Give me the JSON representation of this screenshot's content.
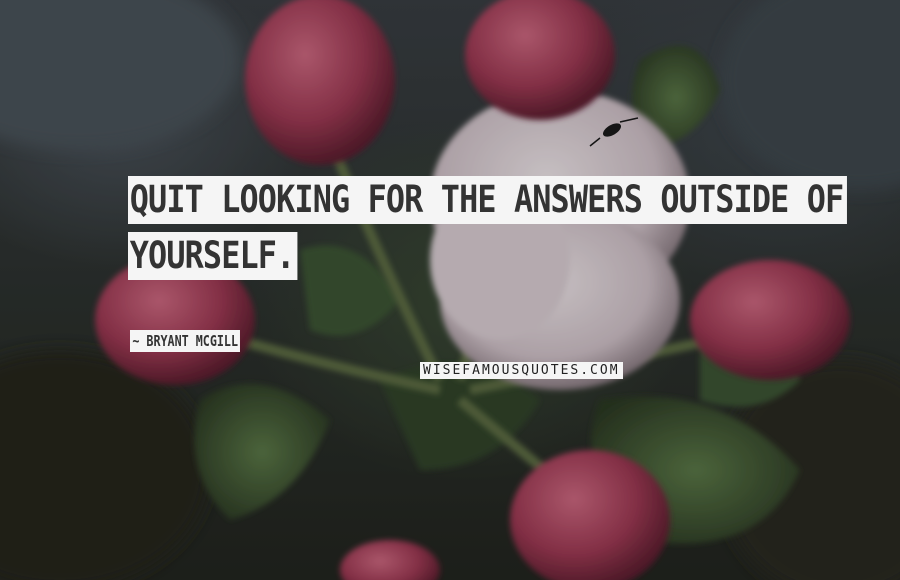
{
  "quote": {
    "line1": "QUIT LOOKING FOR THE ANSWERS OUTSIDE OF",
    "line2": "YOURSELF."
  },
  "author": "~ BRYANT MCGILL",
  "watermark": "WISEFAMOUSQUOTES.COM",
  "background": {
    "subject": "apple blossom buds",
    "colors": {
      "bud_pink": "#c0506a",
      "bud_dark": "#8a2c44",
      "petal_white": "#e8dde2",
      "leaf_green": "#4a6a3a",
      "backdrop_gray": "#3a3f44"
    }
  }
}
